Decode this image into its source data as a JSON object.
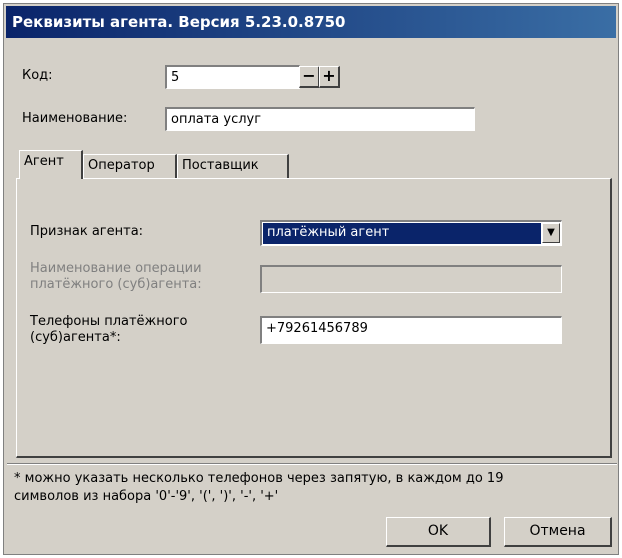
{
  "window": {
    "title": "Реквизиты агента. Версия 5.23.0.8750"
  },
  "header": {
    "code_label": "Код:",
    "code_value": "5",
    "minus_label": "−",
    "plus_label": "+",
    "name_label": "Наименование:",
    "name_value": "оплата услуг"
  },
  "tabs": [
    {
      "label": "Агент",
      "active": true
    },
    {
      "label": "Оператор",
      "active": false
    },
    {
      "label": "Поставщик",
      "active": false
    }
  ],
  "agent_tab": {
    "sign_label": "Признак агента:",
    "sign_value": "платёжный агент",
    "operation_label_line1": "Наименование операции",
    "operation_label_line2": "платёжного (суб)агента:",
    "operation_value": "",
    "phones_label_line1": "Телефоны платёжного",
    "phones_label_line2": "(суб)агента*:",
    "phones_value": "+79261456789"
  },
  "footnote": {
    "line1": "*  можно указать несколько телефонов через запятую, в каждом до 19",
    "line2": "символов из набора '0'-'9', '(', ')', '-', '+'"
  },
  "buttons": {
    "ok": "OK",
    "cancel": "Отмена"
  }
}
